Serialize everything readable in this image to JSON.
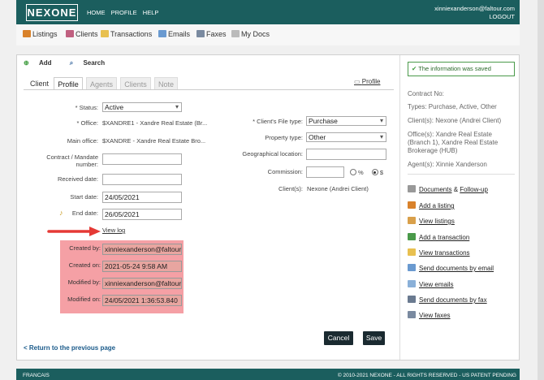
{
  "header": {
    "logo": "NEXONE",
    "nav": [
      "HOME",
      "PROFILE",
      "HELP"
    ],
    "user_email": "xinniexanderson@faltour.com",
    "logout": "LOGOUT"
  },
  "subnav": {
    "listings": "Listings",
    "clients": "Clients",
    "transactions": "Transactions",
    "emails": "Emails",
    "faxes": "Faxes",
    "my_docs": "My Docs"
  },
  "toolbar": {
    "add": "Add",
    "search": "Search"
  },
  "tabs": {
    "client": "Client",
    "profile": "Profile",
    "agents": "Agents",
    "clients": "Clients",
    "note": "Note"
  },
  "profile_link": "Profile",
  "form": {
    "status_label": "* Status:",
    "status_value": "Active",
    "office_label": "* Office:",
    "office_value": "$XANDRE1 - Xandre Real Estate (Br...",
    "main_office_label": "Main office:",
    "main_office_value": "$XANDRE - Xandre Real Estate Bro...",
    "contract_label_1": "Contract / Mandate",
    "contract_label_2": "number:",
    "contract_value": "",
    "received_label": "Received date:",
    "received_value": "",
    "start_label": "Start date:",
    "start_value": "24/05/2021",
    "end_label": "End date:",
    "end_value": "26/05/2021",
    "view_log": "View log",
    "created_by_label": "Created by:",
    "created_by_value": "xinniexanderson@faltour",
    "created_on_label": "Created on:",
    "created_on_value": "2021-05-24 9:58 AM",
    "modified_by_label": "Modified by:",
    "modified_by_value": "xinniexanderson@faltour",
    "modified_on_label": "Modified on:",
    "modified_on_value": "24/05/2021 1:36:53.840",
    "file_type_label": "* Client's File type:",
    "file_type_value": "Purchase",
    "property_type_label": "Property type:",
    "property_type_value": "Other",
    "geo_label": "Geographical location:",
    "geo_value": "",
    "commission_label": "Commission:",
    "commission_value": "",
    "commission_pct": "%",
    "commission_dollar": "$",
    "clients_label": "Client(s):",
    "clients_value": "Nexone (Andrei Client)"
  },
  "buttons": {
    "cancel": "Cancel",
    "save": "Save"
  },
  "return_link": "< Return to the previous page",
  "sidebar": {
    "saved_message": "The information was saved",
    "contract_no": "Contract No:",
    "types": "Types:  Purchase, Active, Other",
    "clients": "Client(s):  Nexone (Andrei Client)",
    "offices_1": "Office(s):  Xandre Real Estate",
    "offices_2": "(Branch 1), Xandre Real Estate",
    "offices_3": "Brokerage (HUB)",
    "agents": "Agent(s):  Xinnie Xanderson",
    "documents": "Documents",
    "documents_amp": " & ",
    "follow_up": "Follow-up",
    "add_listing": "Add a listing",
    "view_listings": "View listings",
    "add_transaction": "Add a transaction",
    "view_transactions": "View transactions",
    "send_docs_email": "Send documents by email",
    "view_emails": "View emails",
    "send_docs_fax": "Send documents by fax",
    "view_faxes": "View faxes"
  },
  "footer": {
    "language": "FRANCAIS",
    "copyright": "© 2010-2021 NEXONE - ALL RIGHTS RESERVED - US PATENT PENDING"
  },
  "colors": {
    "brand": "#1b5e5e",
    "highlight": "#f5a0a5",
    "button": "#1a2a30",
    "arrow": "#e53935"
  }
}
